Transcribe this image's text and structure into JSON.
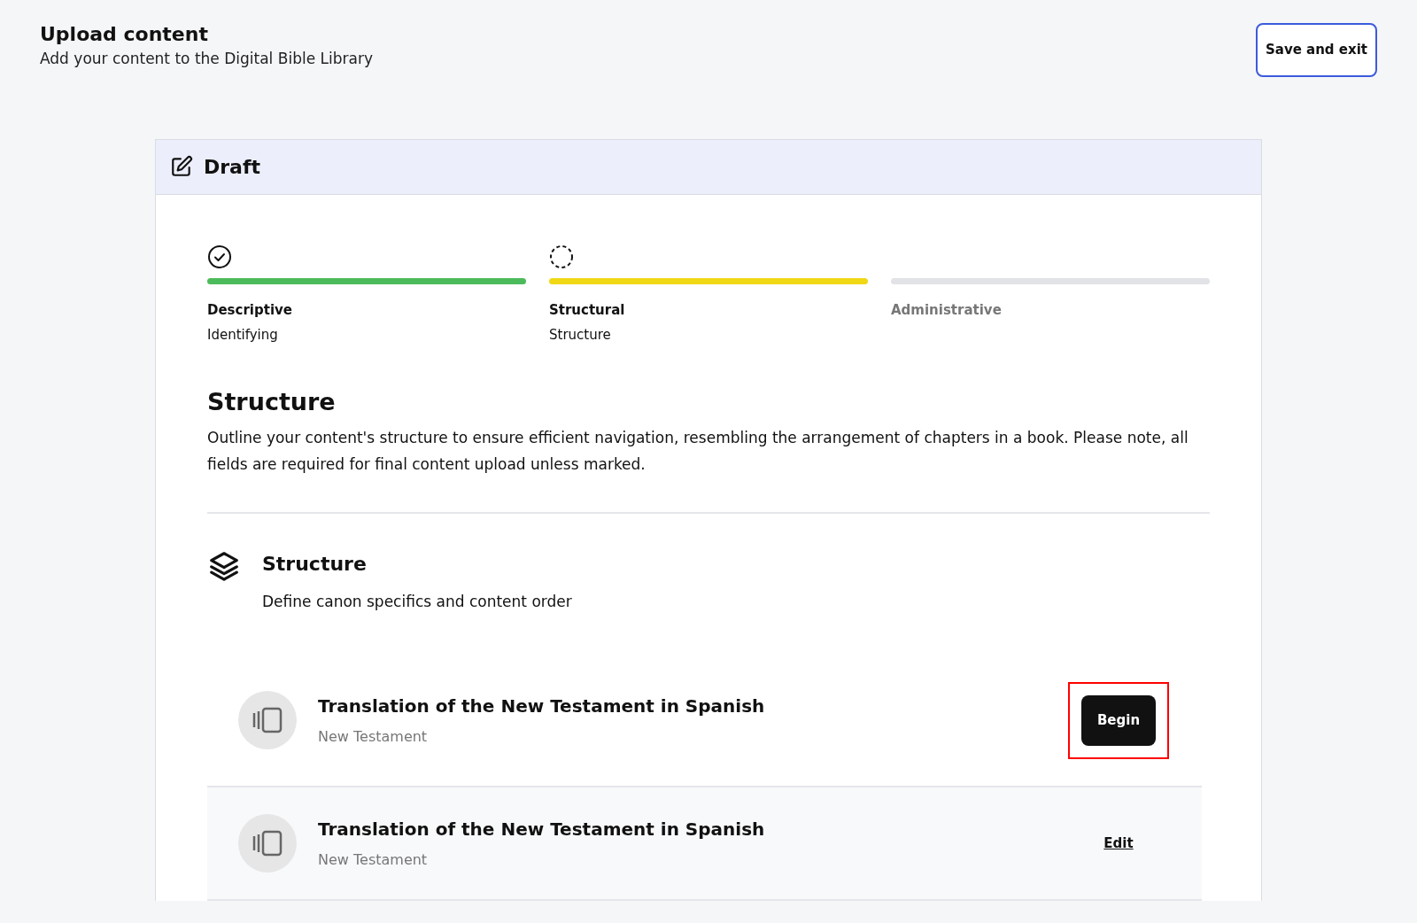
{
  "header": {
    "title": "Upload content",
    "subtitle": "Add your content to the Digital Bible Library",
    "save_button": "Save and exit"
  },
  "card": {
    "title": "Draft",
    "steps": [
      {
        "kind": "done",
        "label": "Descriptive",
        "sublabel": "Identifying"
      },
      {
        "kind": "current",
        "label": "Structural",
        "sublabel": "Structure"
      },
      {
        "kind": "todo",
        "label": "Administrative"
      }
    ],
    "section_title": "Structure",
    "section_text": "Outline your content's structure to ensure efficient navigation, resembling the arrangement of chapters in a book. Please note, all fields are required for final content upload unless marked.",
    "group": {
      "title": "Structure",
      "subtitle": "Define canon specifics and content order"
    },
    "items": [
      {
        "title": "Translation of the New Testament in Spanish",
        "subtitle": "New Testament",
        "action": "Begin",
        "kind": "button",
        "highlighted": true
      },
      {
        "title": "Translation of the New Testament in Spanish",
        "subtitle": "New Testament",
        "action": "Edit",
        "kind": "link",
        "highlighted": false
      }
    ]
  }
}
